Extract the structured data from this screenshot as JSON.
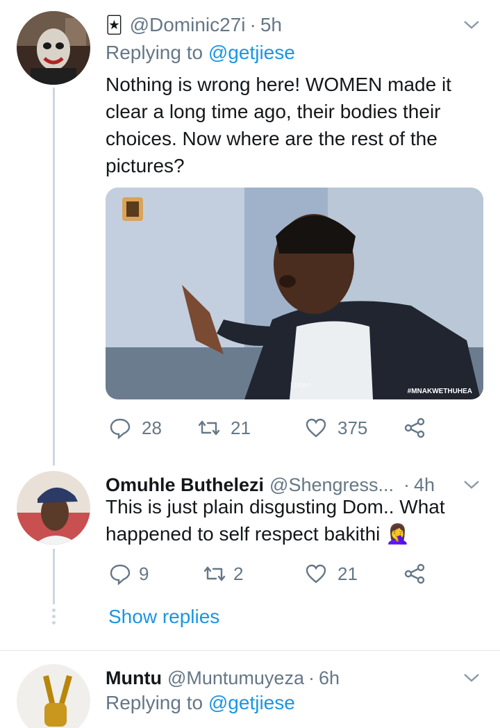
{
  "tweets": [
    {
      "handle": "@Dominic27i",
      "dot": "·",
      "time": "5h",
      "replying_prefix": "Replying to",
      "replying_to": "@getjiese",
      "body_lines": [
        "Nothing is wrong here! WOMEN made it",
        "clear a long time ago, their bodies their",
        "choices. Now where are the rest of the",
        "pictures?"
      ],
      "media": {
        "watermark_left": "Listen",
        "watermark_right": "#MNAKWETHUHEA"
      },
      "stats": {
        "replies": "28",
        "retweets": "21",
        "likes": "375"
      }
    },
    {
      "name": "Omuhle Buthelezi",
      "handle": "@Shengress...",
      "dot": "·",
      "time": "4h",
      "body_lines": [
        "This is just plain disgusting Dom.. What",
        "happened to self respect bakithi"
      ],
      "emoji": "🤦‍♀️",
      "stats": {
        "replies": "9",
        "retweets": "2",
        "likes": "21"
      },
      "show_replies": "Show replies"
    },
    {
      "name": "Muntu",
      "handle": "@Muntumuyeza",
      "dot": "·",
      "time": "6h",
      "replying_prefix": "Replying to",
      "replying_to": "@getjiese"
    }
  ],
  "icons": {
    "reply": "reply-icon",
    "retweet": "retweet-icon",
    "like": "heart-icon",
    "share": "share-icon",
    "more": "chevron-down-icon"
  },
  "colors": {
    "link": "#1b95e0",
    "secondary_text": "#657786",
    "thread_line": "#ccd6dd"
  }
}
